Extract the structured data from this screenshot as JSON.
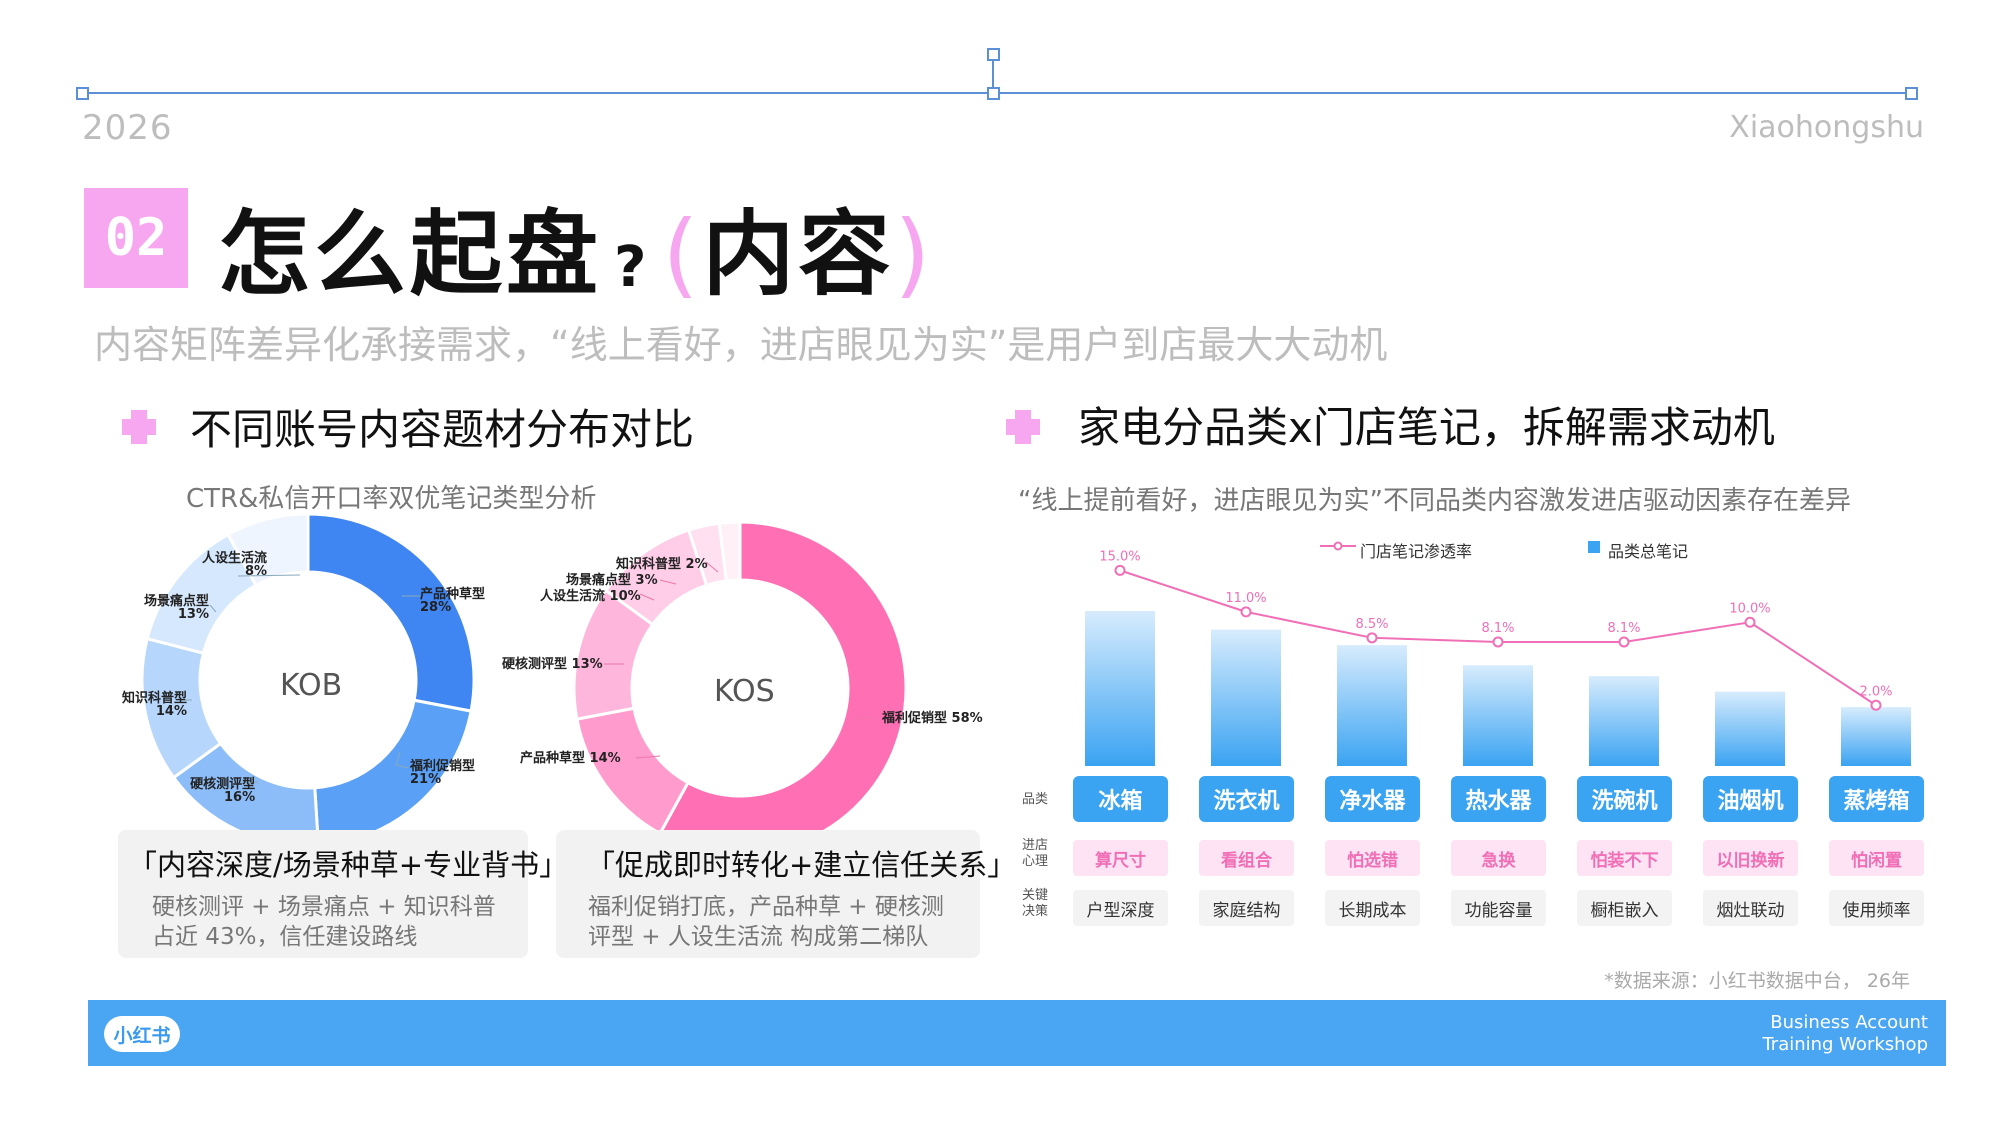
{
  "header": {
    "year": "2026",
    "brand": "Xiaohongshu"
  },
  "title": {
    "badge": "02",
    "main": "怎么起盘",
    "question": "?",
    "paren_open": "(",
    "paren_text": "内容",
    "paren_close": ")"
  },
  "subtitle": "内容矩阵差异化承接需求，“线上看好，进店眼见为实”是用户到店最大大动机",
  "left": {
    "title": "不同账号内容题材分布对比",
    "subtitle": "CTR&私信开口率双优笔记类型分析",
    "kob": {
      "center": "KOB",
      "labels": [
        {
          "name": "产品种草型",
          "pct": "28%"
        },
        {
          "name": "福利促销型",
          "pct": "21%"
        },
        {
          "name": "硬核测评型",
          "pct": "16%"
        },
        {
          "name": "知识科普型",
          "pct": "14%"
        },
        {
          "name": "场景痛点型",
          "pct": "13%"
        },
        {
          "name": "人设生活流",
          "pct": "8%"
        }
      ]
    },
    "kos": {
      "center": "KOS",
      "labels": [
        {
          "text": "福利促销型 58%"
        },
        {
          "text": "产品种草型 14%"
        },
        {
          "text": "硬核测评型 13%"
        },
        {
          "text": "人设生活流 10%"
        },
        {
          "text": "场景痛点型 3%"
        },
        {
          "text": "知识科普型 2%"
        }
      ]
    },
    "box1": {
      "heading": "「内容深度/场景种草+专业背书」",
      "line1": "硬核测评 + 场景痛点 + 知识科普",
      "line2": "占近 43%，信任建设路线"
    },
    "box2": {
      "heading": "「促成即时转化+建立信任关系」",
      "line1": "福利促销打底，产品种草 + 硬核测",
      "line2": "评型 + 人设生活流 构成第二梯队"
    }
  },
  "right": {
    "title": "家电分品类x门店笔记，拆解需求动机",
    "subtitle": "“线上提前看好，进店眼见为实”不同品类内容激发进店驱动因素存在差异",
    "legend": {
      "line": "门店笔记渗透率",
      "bar": "品类总笔记"
    },
    "row_labels": {
      "category": "品类",
      "mind": "进店心理",
      "decision": "关键决策"
    },
    "source": "*数据来源：小红书数据中台，  26年"
  },
  "chart_data": [
    {
      "type": "pie",
      "title": "KOB",
      "categories": [
        "产品种草型",
        "福利促销型",
        "硬核测评型",
        "知识科普型",
        "场景痛点型",
        "人设生活流"
      ],
      "values": [
        28,
        21,
        16,
        14,
        13,
        8
      ],
      "colors": [
        "#3f86f2",
        "#5aa0f6",
        "#8cbdf8",
        "#b6d6fb",
        "#d6e8fd",
        "#eef5fe"
      ]
    },
    {
      "type": "pie",
      "title": "KOS",
      "categories": [
        "福利促销型",
        "产品种草型",
        "硬核测评型",
        "人设生活流",
        "场景痛点型",
        "知识科普型"
      ],
      "values": [
        58,
        14,
        13,
        10,
        3,
        2
      ],
      "colors": [
        "#ff6fb3",
        "#ff9ccd",
        "#ffb6dc",
        "#ffcde8",
        "#ffe0f0",
        "#fff0f8"
      ]
    },
    {
      "type": "bar",
      "categories": [
        "冰箱",
        "洗衣机",
        "净水器",
        "热水器",
        "洗碗机",
        "油烟机",
        "蒸烤箱"
      ],
      "series": [
        {
          "name": "品类总笔记",
          "values": [
            100,
            88,
            78,
            65,
            58,
            48,
            38
          ]
        },
        {
          "name": "门店笔记渗透率",
          "values": [
            15.0,
            11.0,
            8.5,
            8.1,
            8.1,
            10.0,
            2.0
          ],
          "labels": [
            "15.0%",
            "11.0%",
            "8.5%",
            "8.1%",
            "8.1%",
            "10.0%",
            "2.0%"
          ]
        }
      ],
      "mind": [
        "算尺寸",
        "看组合",
        "怕选错",
        "急换",
        "怕装不下",
        "以旧换新",
        "怕闲置"
      ],
      "decision": [
        "户型深度",
        "家庭结构",
        "长期成本",
        "功能容量",
        "橱柜嵌入",
        "烟灶联动",
        "使用频率"
      ],
      "bar_color": "#3aa3f2",
      "line_color": "#f06fb6",
      "ylim_line": [
        0,
        16
      ]
    }
  ],
  "footer": {
    "logo": "小红书",
    "line1": "Business Account",
    "line2": "Training Workshop"
  }
}
